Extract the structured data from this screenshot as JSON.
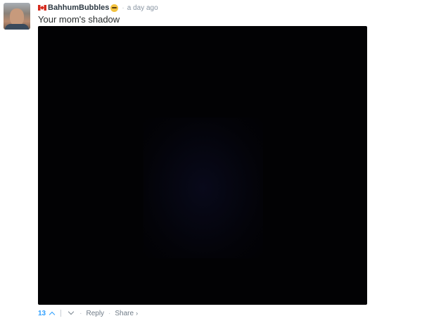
{
  "comment": {
    "username": "BahhumBubbles",
    "timestamp": "a day ago",
    "text": "Your mom's shadow",
    "separator": "·",
    "flag_icon": "canada-flag-icon",
    "badge_icon": "nerd-face-emoji-icon"
  },
  "footer": {
    "vote_count": "13",
    "reply_label": "Reply",
    "share_label": "Share",
    "share_chevron": "›",
    "separator": "·"
  },
  "colors": {
    "accent": "#2e9fff",
    "username": "#2e3a44",
    "meta": "#8a96a3",
    "media_background": "#020204"
  }
}
